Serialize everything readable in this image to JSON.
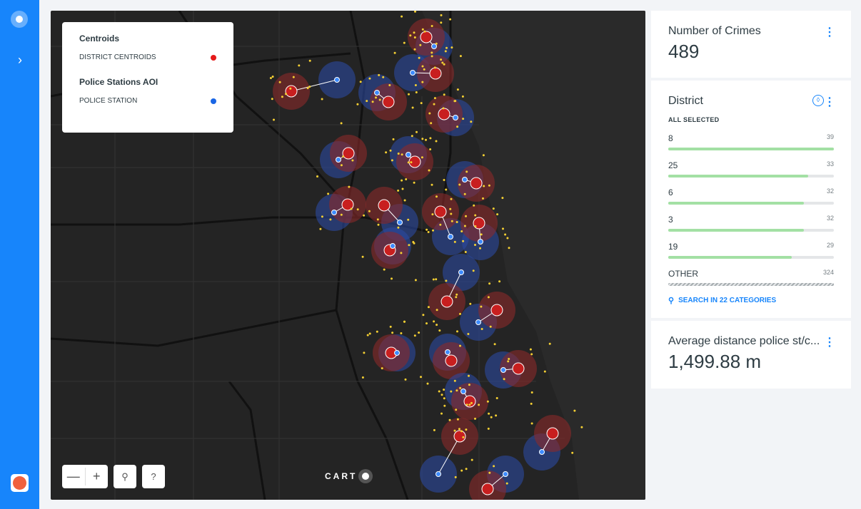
{
  "rail": {
    "expand_icon": "›"
  },
  "legend": {
    "sections": [
      {
        "title": "Centroids",
        "item": "DISTRICT CENTROIDS",
        "color": "#e51a1a"
      },
      {
        "title": "Police Stations AOI",
        "item": "POLICE STATION",
        "color": "#1a66e5"
      }
    ]
  },
  "map_controls": {
    "zoom_out": "—",
    "zoom_in": "+",
    "search": "⚲",
    "help": "?"
  },
  "attribution": "CART",
  "widgets": {
    "crimes": {
      "title": "Number of Crimes",
      "value": "489"
    },
    "district": {
      "title": "District",
      "all_selected": "ALL SELECTED",
      "categories": [
        {
          "label": "8",
          "count": "39"
        },
        {
          "label": "25",
          "count": "33"
        },
        {
          "label": "6",
          "count": "32"
        },
        {
          "label": "3",
          "count": "32"
        },
        {
          "label": "19",
          "count": "29"
        },
        {
          "label": "OTHER",
          "count": "324"
        }
      ],
      "search_label": "SEARCH IN 22 CATEGORIES"
    },
    "distance": {
      "title": "Average distance police st/c...",
      "value": "1,499.88 m"
    }
  },
  "kebab_icon": "⋮",
  "drop_icon": "◊"
}
